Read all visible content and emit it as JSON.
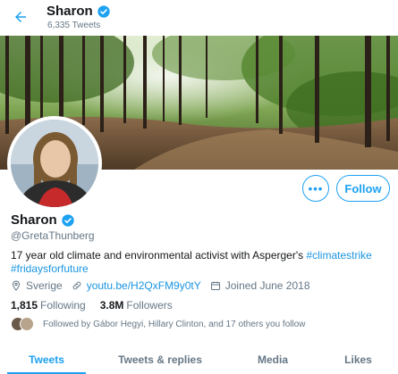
{
  "header": {
    "name": "Sharon",
    "tweet_count": "6,335 Tweets"
  },
  "profile": {
    "name": "Sharon",
    "handle": "@GretaThunberg",
    "bio_text": "17 year old climate and environmental activist with Asperger's ",
    "bio_hashtag_1": "#climatestrike",
    "bio_hashtag_2": "#fridaysforfuture",
    "location": "Sverige",
    "website": "youtu.be/H2QxFM9y0tY",
    "joined": "Joined June 2018"
  },
  "stats": {
    "following_count": "1,815",
    "following_label": "Following",
    "followers_count": "3.8M",
    "followers_label": "Followers"
  },
  "followed_by": "Followed by Gábor Hegyi, Hillary Clinton, and 17 others you follow",
  "actions": {
    "more_label": "•••",
    "follow_label": "Follow"
  },
  "tabs": [
    {
      "label": "Tweets",
      "active": true
    },
    {
      "label": "Tweets & replies",
      "active": false
    },
    {
      "label": "Media",
      "active": false
    },
    {
      "label": "Likes",
      "active": false
    }
  ],
  "colors": {
    "accent": "#1da1f2",
    "link": "#1b95e0",
    "secondary_text": "#657786"
  },
  "icons": {
    "back": "arrow-left-icon",
    "verified": "verified-badge-icon",
    "location": "location-pin-icon",
    "link": "link-icon",
    "calendar": "calendar-icon"
  }
}
